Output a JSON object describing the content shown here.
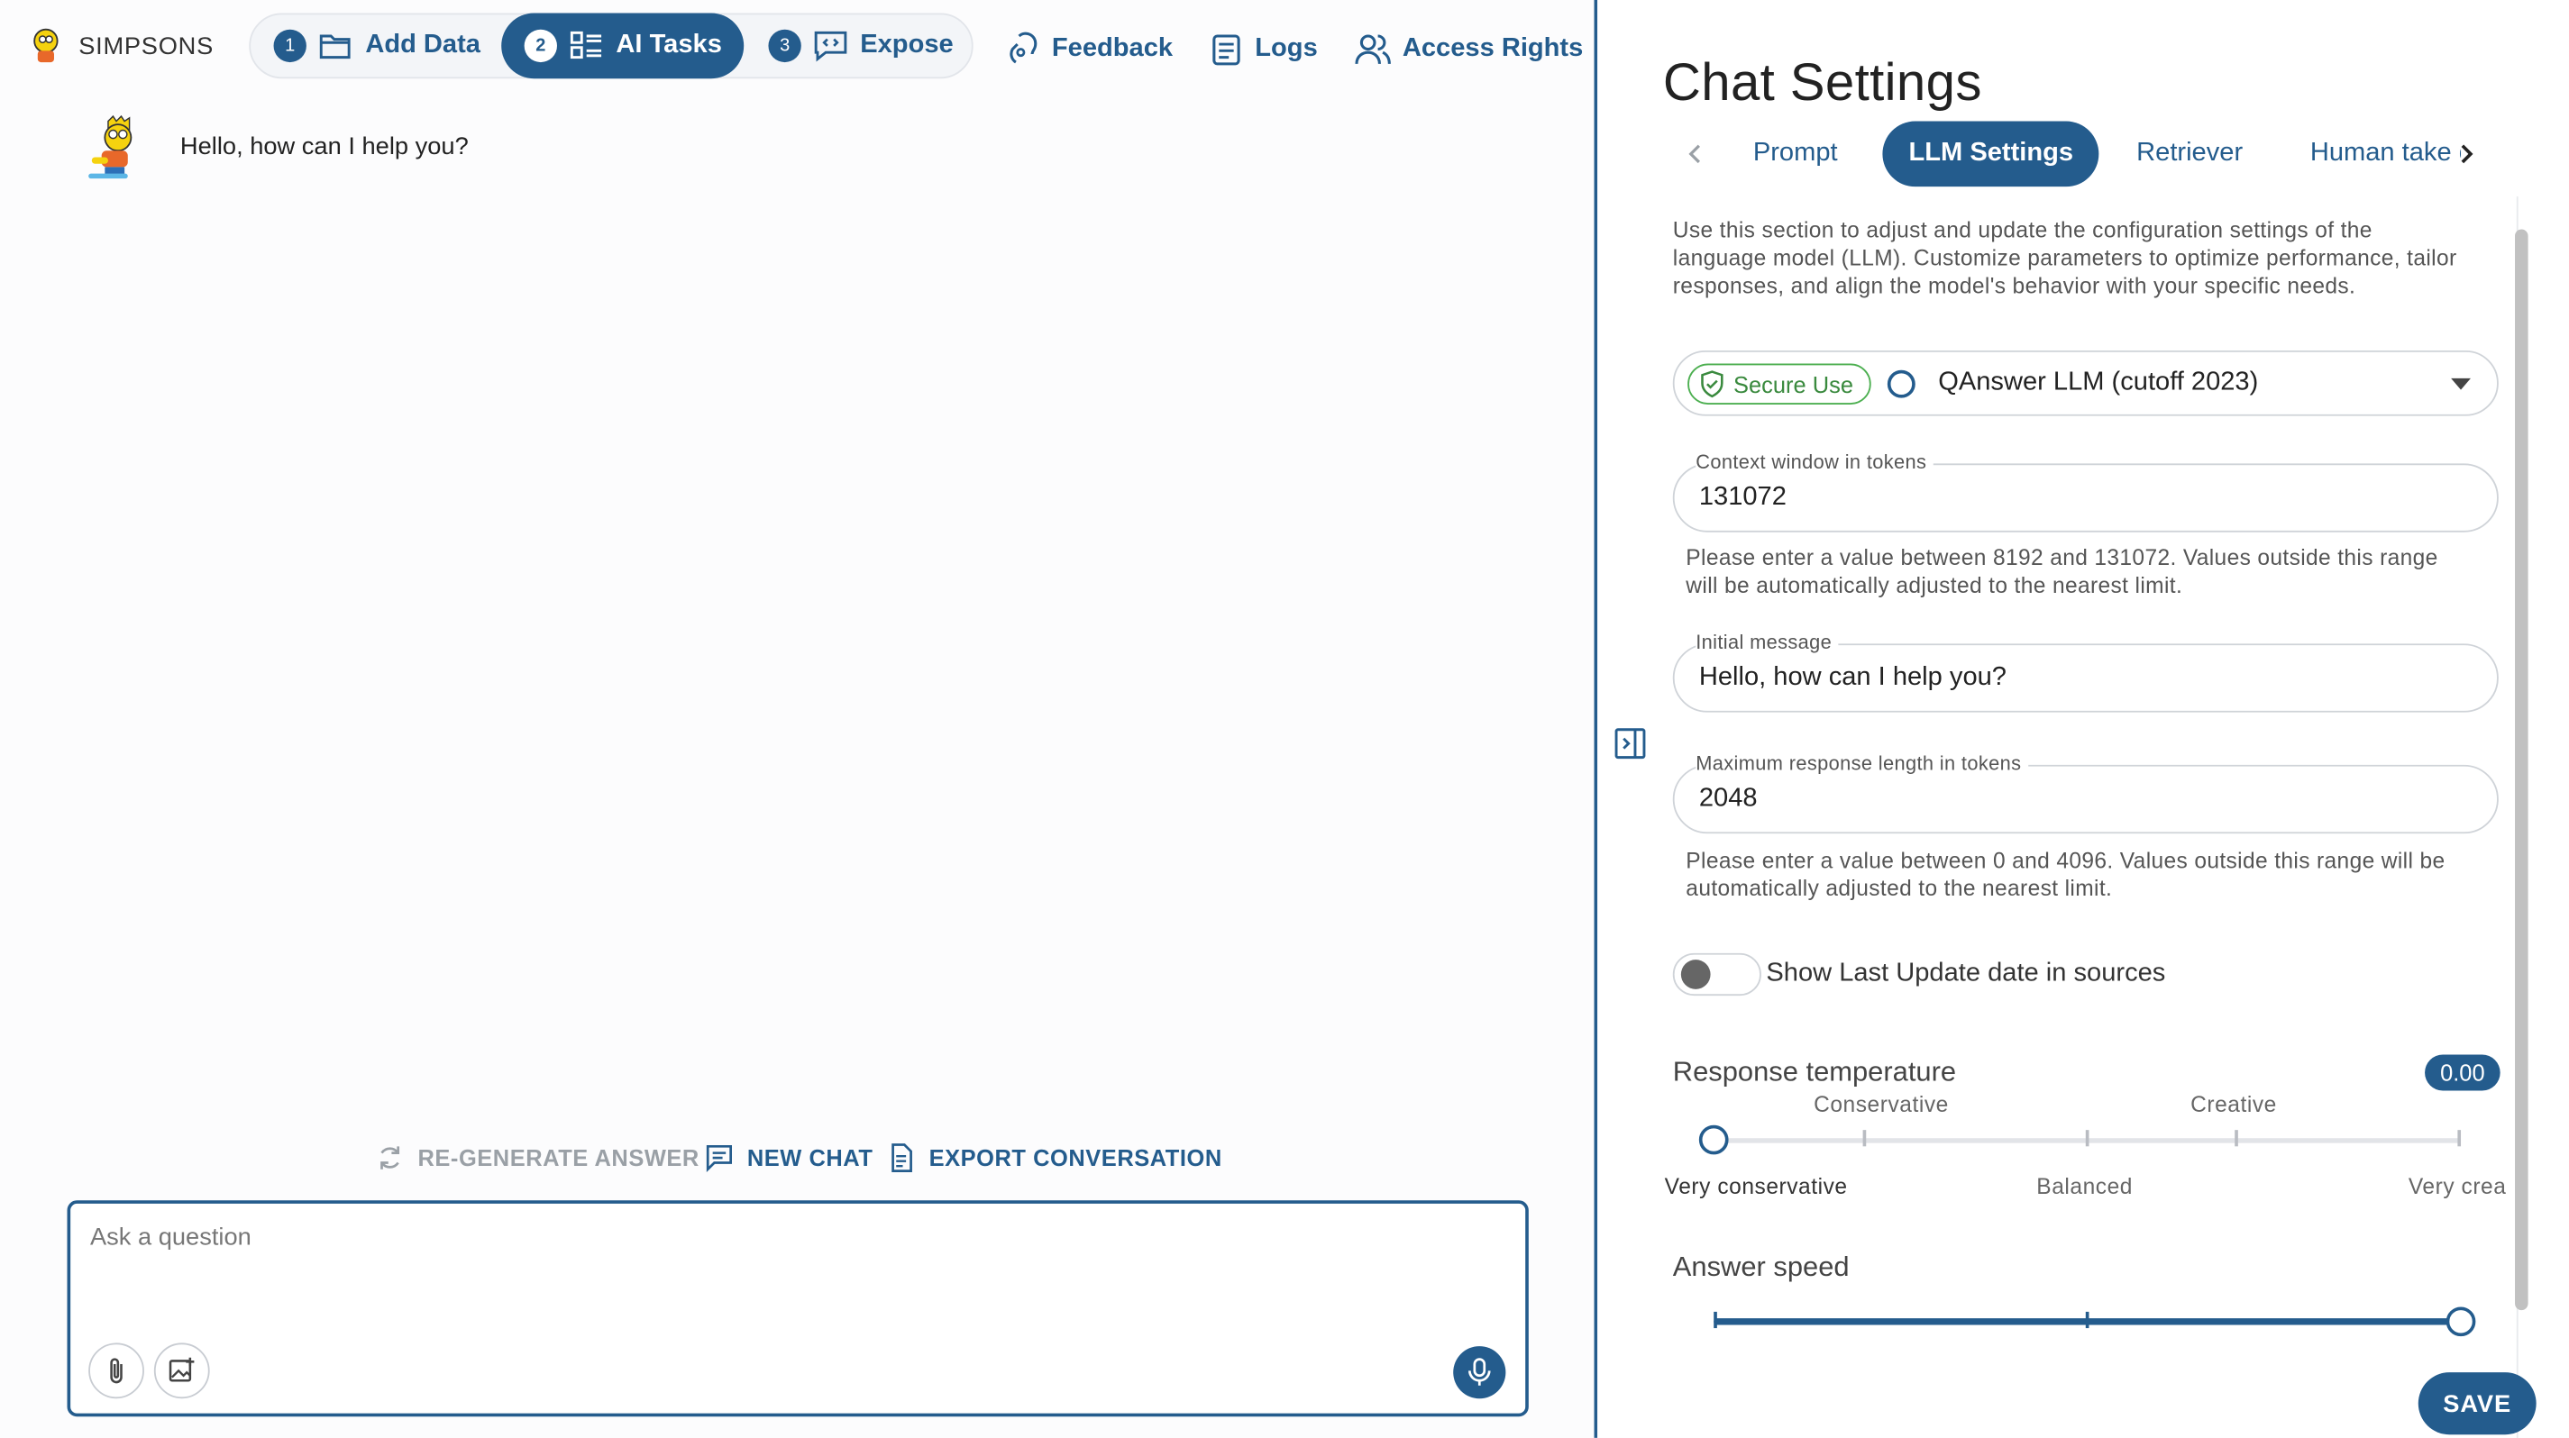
{
  "brand": {
    "name": "SIMPSONS"
  },
  "stepper": [
    {
      "num": "1",
      "label": "Add Data",
      "icon": "folder-icon"
    },
    {
      "num": "2",
      "label": "AI Tasks",
      "icon": "tasks-icon",
      "active": true
    },
    {
      "num": "3",
      "label": "Expose",
      "icon": "code-chat-icon"
    }
  ],
  "topnav": {
    "feedback": "Feedback",
    "logs": "Logs",
    "access_rights": "Access Rights"
  },
  "chat": {
    "message": "Hello, how can I help you?",
    "actions": {
      "regenerate": "RE-GENERATE ANSWER",
      "new_chat": "NEW CHAT",
      "export": "EXPORT CONVERSATION"
    },
    "input_placeholder": "Ask a question"
  },
  "settings": {
    "title": "Chat Settings",
    "tabs": [
      "Prompt",
      "LLM Settings",
      "Retriever",
      "Human take o"
    ],
    "active_tab": "LLM Settings",
    "intro": "Use this section to adjust and update the configuration settings of the language model (LLM). Customize parameters to optimize performance, tailor responses, and align the model's behavior with your specific needs.",
    "model": {
      "chip": "Secure Use",
      "name": "QAnswer LLM (cutoff 2023)"
    },
    "context_window": {
      "label": "Context window in tokens",
      "value": "131072",
      "helper": "Please enter a value between 8192 and 131072. Values outside this range will be automatically adjusted to the nearest limit."
    },
    "initial_message": {
      "label": "Initial message",
      "value": "Hello, how can I help you?"
    },
    "max_response": {
      "label": "Maximum response length in tokens",
      "value": "2048",
      "helper": "Please enter a value between 0 and 4096. Values outside this range will be automatically adjusted to the nearest limit."
    },
    "toggle": {
      "label": "Show Last Update date in sources",
      "on": false
    },
    "temperature": {
      "label": "Response temperature",
      "value": "0.00",
      "level": 0,
      "marks_top": [
        "Conservative",
        "Creative"
      ],
      "marks_bottom": [
        "Very conservative",
        "Balanced",
        "Very crea"
      ]
    },
    "speed": {
      "label": "Answer speed",
      "level": 1
    },
    "save": "SAVE"
  },
  "colors": {
    "accent": "#245c8d",
    "secure": "#4caf50"
  }
}
